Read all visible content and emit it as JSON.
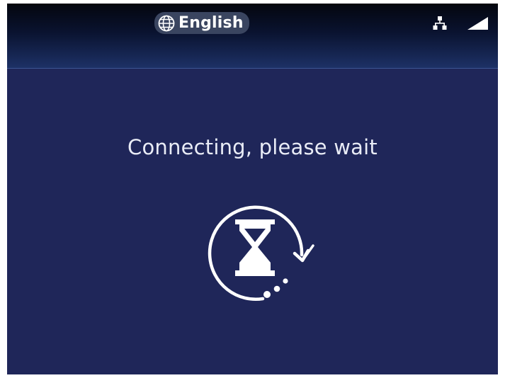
{
  "header": {
    "language": {
      "label": "English",
      "icon": "globe-icon"
    },
    "status_icons": [
      "network-icon",
      "signal-icon"
    ]
  },
  "main": {
    "message": "Connecting, please wait",
    "spinner_icon": "hourglass-icon"
  },
  "colors": {
    "background": "#1f2659",
    "header_top": "#04060e",
    "header_bottom": "#1d3166",
    "pill": "#3a4560",
    "text": "#ffffff"
  }
}
